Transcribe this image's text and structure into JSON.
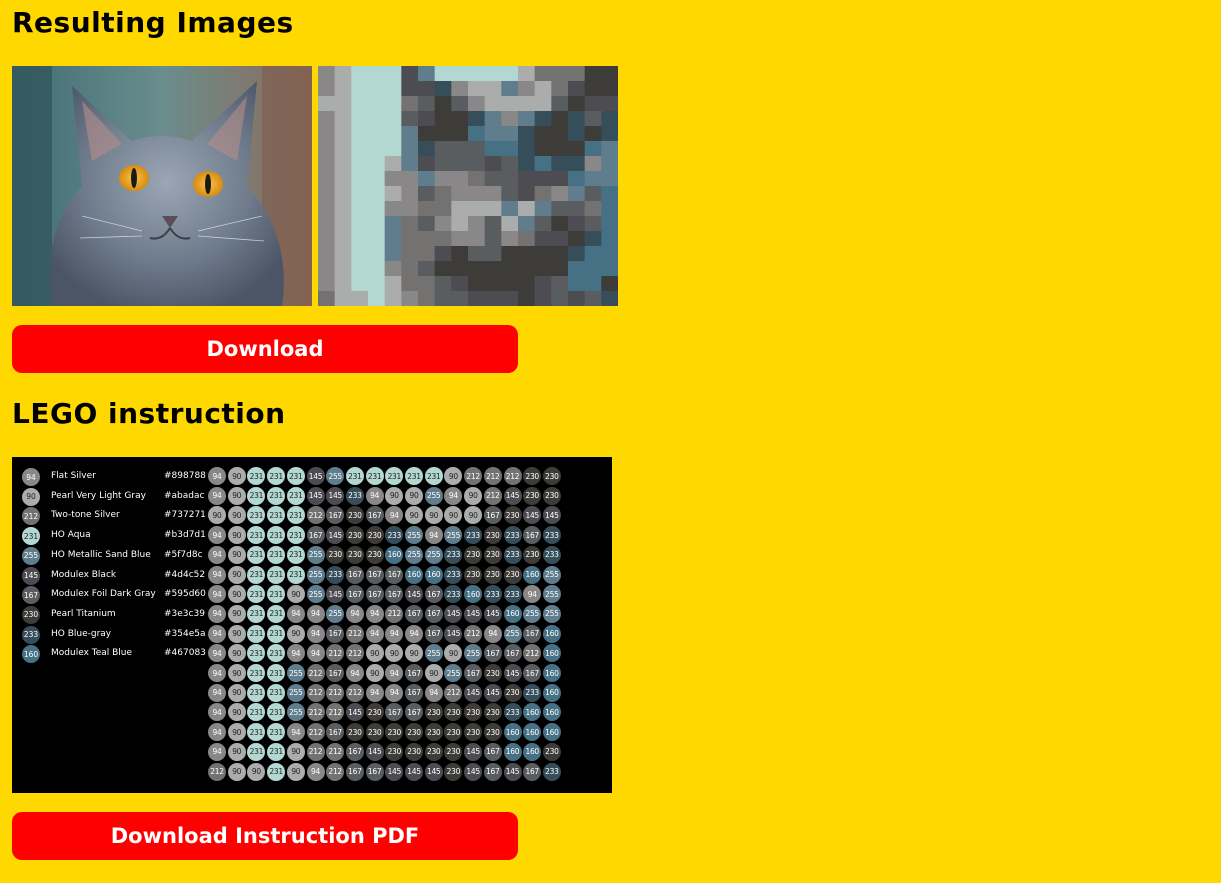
{
  "section1": {
    "title": "Resulting Images"
  },
  "download_button": {
    "label": "Download"
  },
  "section2": {
    "title": "LEGO instruction"
  },
  "pdf_button": {
    "label": "Download Instruction PDF"
  },
  "colors": {
    "background": "#ffd800",
    "button": "#ff0000",
    "button_text": "#ffffff"
  },
  "palette": [
    {
      "id": "94",
      "name": "Flat Silver",
      "hex": "#898788"
    },
    {
      "id": "90",
      "name": "Pearl Very Light Gray",
      "hex": "#abadac"
    },
    {
      "id": "212",
      "name": "Two-tone Silver",
      "hex": "#737271"
    },
    {
      "id": "231",
      "name": "HO Aqua",
      "hex": "#b3d7d1"
    },
    {
      "id": "255",
      "name": "HO Metallic Sand Blue",
      "hex": "#5f7d8c"
    },
    {
      "id": "145",
      "name": "Modulex Black",
      "hex": "#4d4c52"
    },
    {
      "id": "167",
      "name": "Modulex Foil Dark Gray",
      "hex": "#595d60"
    },
    {
      "id": "230",
      "name": "Pearl Titanium",
      "hex": "#3e3c39"
    },
    {
      "id": "233",
      "name": "HO Blue-gray",
      "hex": "#354e5a"
    },
    {
      "id": "160",
      "name": "Modulex Teal Blue",
      "hex": "#467083"
    }
  ],
  "instruction_grid": [
    [
      "94",
      "90",
      "231",
      "231",
      "231",
      "145",
      "255",
      "231",
      "231",
      "231",
      "231",
      "231",
      "90",
      "212",
      "212",
      "212",
      "230",
      "230"
    ],
    [
      "94",
      "90",
      "231",
      "231",
      "231",
      "145",
      "145",
      "233",
      "94",
      "90",
      "90",
      "255",
      "94",
      "90",
      "212",
      "145",
      "230",
      "230"
    ],
    [
      "90",
      "90",
      "231",
      "231",
      "231",
      "212",
      "167",
      "230",
      "167",
      "94",
      "90",
      "90",
      "90",
      "90",
      "167",
      "230",
      "145",
      "145"
    ],
    [
      "94",
      "90",
      "231",
      "231",
      "231",
      "167",
      "145",
      "230",
      "230",
      "233",
      "255",
      "94",
      "255",
      "233",
      "230",
      "233",
      "167",
      "233"
    ],
    [
      "94",
      "90",
      "231",
      "231",
      "231",
      "255",
      "230",
      "230",
      "230",
      "160",
      "255",
      "255",
      "233",
      "230",
      "230",
      "233",
      "230",
      "233"
    ],
    [
      "94",
      "90",
      "231",
      "231",
      "231",
      "255",
      "233",
      "167",
      "167",
      "167",
      "160",
      "160",
      "233",
      "230",
      "230",
      "230",
      "160",
      "255"
    ],
    [
      "94",
      "90",
      "231",
      "231",
      "90",
      "255",
      "145",
      "167",
      "167",
      "167",
      "145",
      "167",
      "233",
      "160",
      "233",
      "233",
      "94",
      "255"
    ],
    [
      "94",
      "90",
      "231",
      "231",
      "94",
      "94",
      "255",
      "94",
      "94",
      "212",
      "167",
      "167",
      "145",
      "145",
      "145",
      "160",
      "255",
      "255"
    ],
    [
      "94",
      "90",
      "231",
      "231",
      "90",
      "94",
      "167",
      "212",
      "94",
      "94",
      "94",
      "167",
      "145",
      "212",
      "94",
      "255",
      "167",
      "160"
    ],
    [
      "94",
      "90",
      "231",
      "231",
      "94",
      "94",
      "212",
      "212",
      "90",
      "90",
      "90",
      "255",
      "90",
      "255",
      "167",
      "167",
      "212",
      "160"
    ],
    [
      "94",
      "90",
      "231",
      "231",
      "255",
      "212",
      "167",
      "94",
      "90",
      "94",
      "167",
      "90",
      "255",
      "167",
      "230",
      "145",
      "167",
      "160"
    ],
    [
      "94",
      "90",
      "231",
      "231",
      "255",
      "212",
      "212",
      "212",
      "94",
      "94",
      "167",
      "94",
      "212",
      "145",
      "145",
      "230",
      "233",
      "160"
    ],
    [
      "94",
      "90",
      "231",
      "231",
      "255",
      "212",
      "212",
      "145",
      "230",
      "167",
      "167",
      "230",
      "230",
      "230",
      "230",
      "233",
      "160",
      "160"
    ],
    [
      "94",
      "90",
      "231",
      "231",
      "94",
      "212",
      "167",
      "230",
      "230",
      "230",
      "230",
      "230",
      "230",
      "230",
      "230",
      "160",
      "160",
      "160"
    ],
    [
      "94",
      "90",
      "231",
      "231",
      "90",
      "212",
      "212",
      "167",
      "145",
      "230",
      "230",
      "230",
      "230",
      "145",
      "167",
      "160",
      "160",
      "230"
    ],
    [
      "212",
      "90",
      "90",
      "231",
      "90",
      "94",
      "212",
      "167",
      "167",
      "145",
      "145",
      "145",
      "230",
      "145",
      "167",
      "145",
      "167",
      "233"
    ]
  ]
}
